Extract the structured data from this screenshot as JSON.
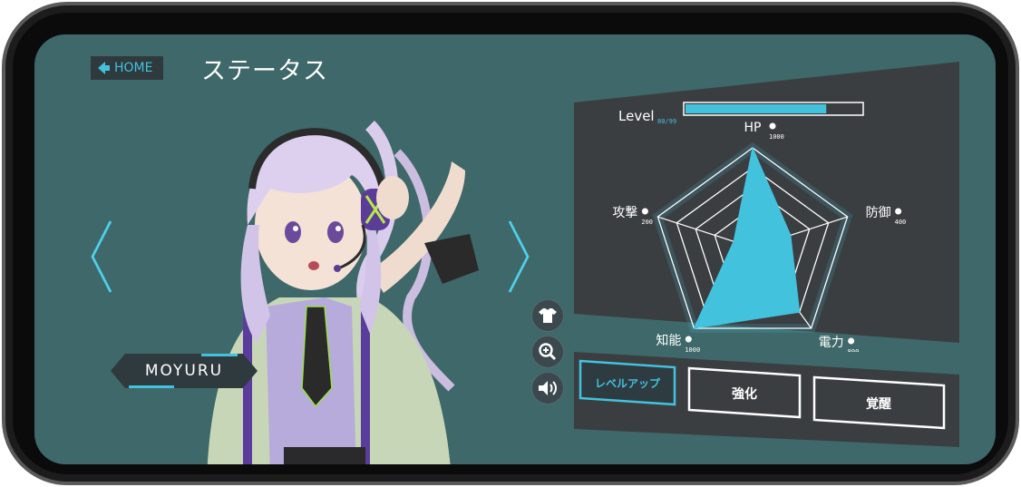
{
  "header": {
    "home_label": "HOME",
    "title": "ステータス"
  },
  "character": {
    "name": "MOYURU"
  },
  "side_controls": [
    {
      "icon": "shirt-icon"
    },
    {
      "icon": "zoom-in-icon"
    },
    {
      "icon": "speaker-icon"
    }
  ],
  "status": {
    "level_label": "Level",
    "level_value": "80/99",
    "level_fill": 0.8,
    "stats": {
      "hp": {
        "label": "HP",
        "value": "1000",
        "icon": "plus-icon"
      },
      "defense": {
        "label": "防御",
        "value": "400",
        "icon": "shield-icon"
      },
      "power": {
        "label": "電力",
        "value": "800",
        "icon": "lightning-icon"
      },
      "intel": {
        "label": "知能",
        "value": "1000",
        "icon": "pencil-icon"
      },
      "attack": {
        "label": "攻撃",
        "value": "200",
        "icon": "sword-icon"
      }
    }
  },
  "chart_data": {
    "type": "radar",
    "axes": [
      "HP",
      "防御",
      "電力",
      "知能",
      "攻撃"
    ],
    "values": [
      1000,
      400,
      800,
      1000,
      200
    ],
    "max": 1000,
    "rings": 5
  },
  "actions": {
    "level_up": "レベルアップ",
    "enhance": "強化",
    "awaken": "覚醒"
  },
  "colors": {
    "screen_bg": "#3e6869",
    "accent": "#43c2dd",
    "panel_bg": "#3b3e41"
  }
}
